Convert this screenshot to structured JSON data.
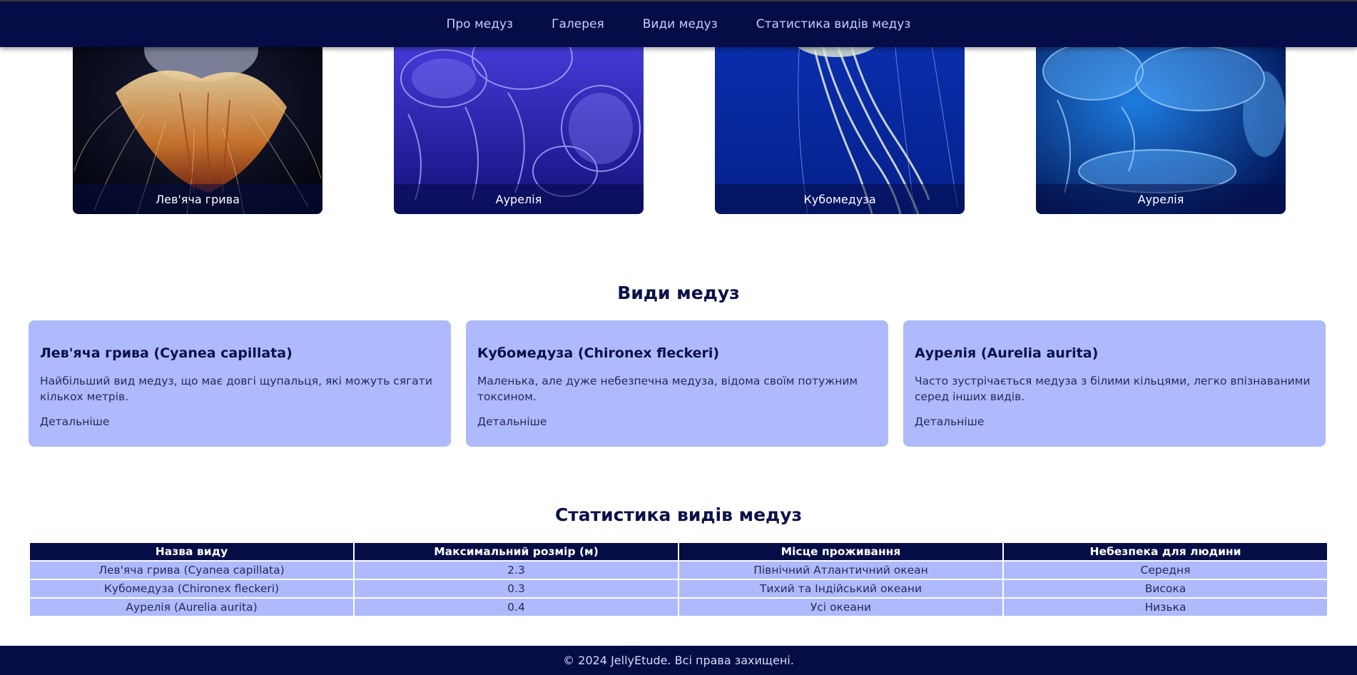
{
  "nav": {
    "items": [
      {
        "label": "Про медуз"
      },
      {
        "label": "Галерея"
      },
      {
        "label": "Види медуз"
      },
      {
        "label": "Статистика видів медуз"
      }
    ]
  },
  "gallery": {
    "items": [
      {
        "caption": "Лев'яча грива"
      },
      {
        "caption": "Аурелія"
      },
      {
        "caption": "Кубомедуза"
      },
      {
        "caption": "Аурелія"
      }
    ]
  },
  "species": {
    "title": "Види медуз",
    "cards": [
      {
        "title": "Лев'яча грива (Cyanea capillata)",
        "description": "Найбільший вид медуз, що має довгі щупальця, які можуть сягати кількох метрів.",
        "link": "Детальніше"
      },
      {
        "title": "Кубомедуза (Chironex fleckeri)",
        "description": "Маленька, але дуже небезпечна медуза, відома своїм потужним токсином.",
        "link": "Детальніше"
      },
      {
        "title": "Аурелія (Aurelia aurita)",
        "description": "Часто зустрічається медуза з білими кільцями, легко впізнаваними серед інших видів.",
        "link": "Детальніше"
      }
    ]
  },
  "stats": {
    "title": "Статистика видів медуз",
    "headers": [
      "Назва виду",
      "Максимальний розмір (м)",
      "Місце проживання",
      "Небезпека для людини"
    ],
    "rows": [
      [
        "Лев'яча грива (Cyanea capillata)",
        "2.3",
        "Північний Атлантичний океан",
        "Середня"
      ],
      [
        "Кубомедуза (Chironex fleckeri)",
        "0.3",
        "Тихий та Індійський океани",
        "Висока"
      ],
      [
        "Аурелія (Aurelia aurita)",
        "0.4",
        "Усі океани",
        "Низька"
      ]
    ]
  },
  "footer": {
    "text": "© 2024 JellyEtude. Всі права захищені."
  },
  "colors": {
    "nav_bg": "#060c45",
    "card_bg": "#aebafb",
    "heading": "#0b1148"
  }
}
